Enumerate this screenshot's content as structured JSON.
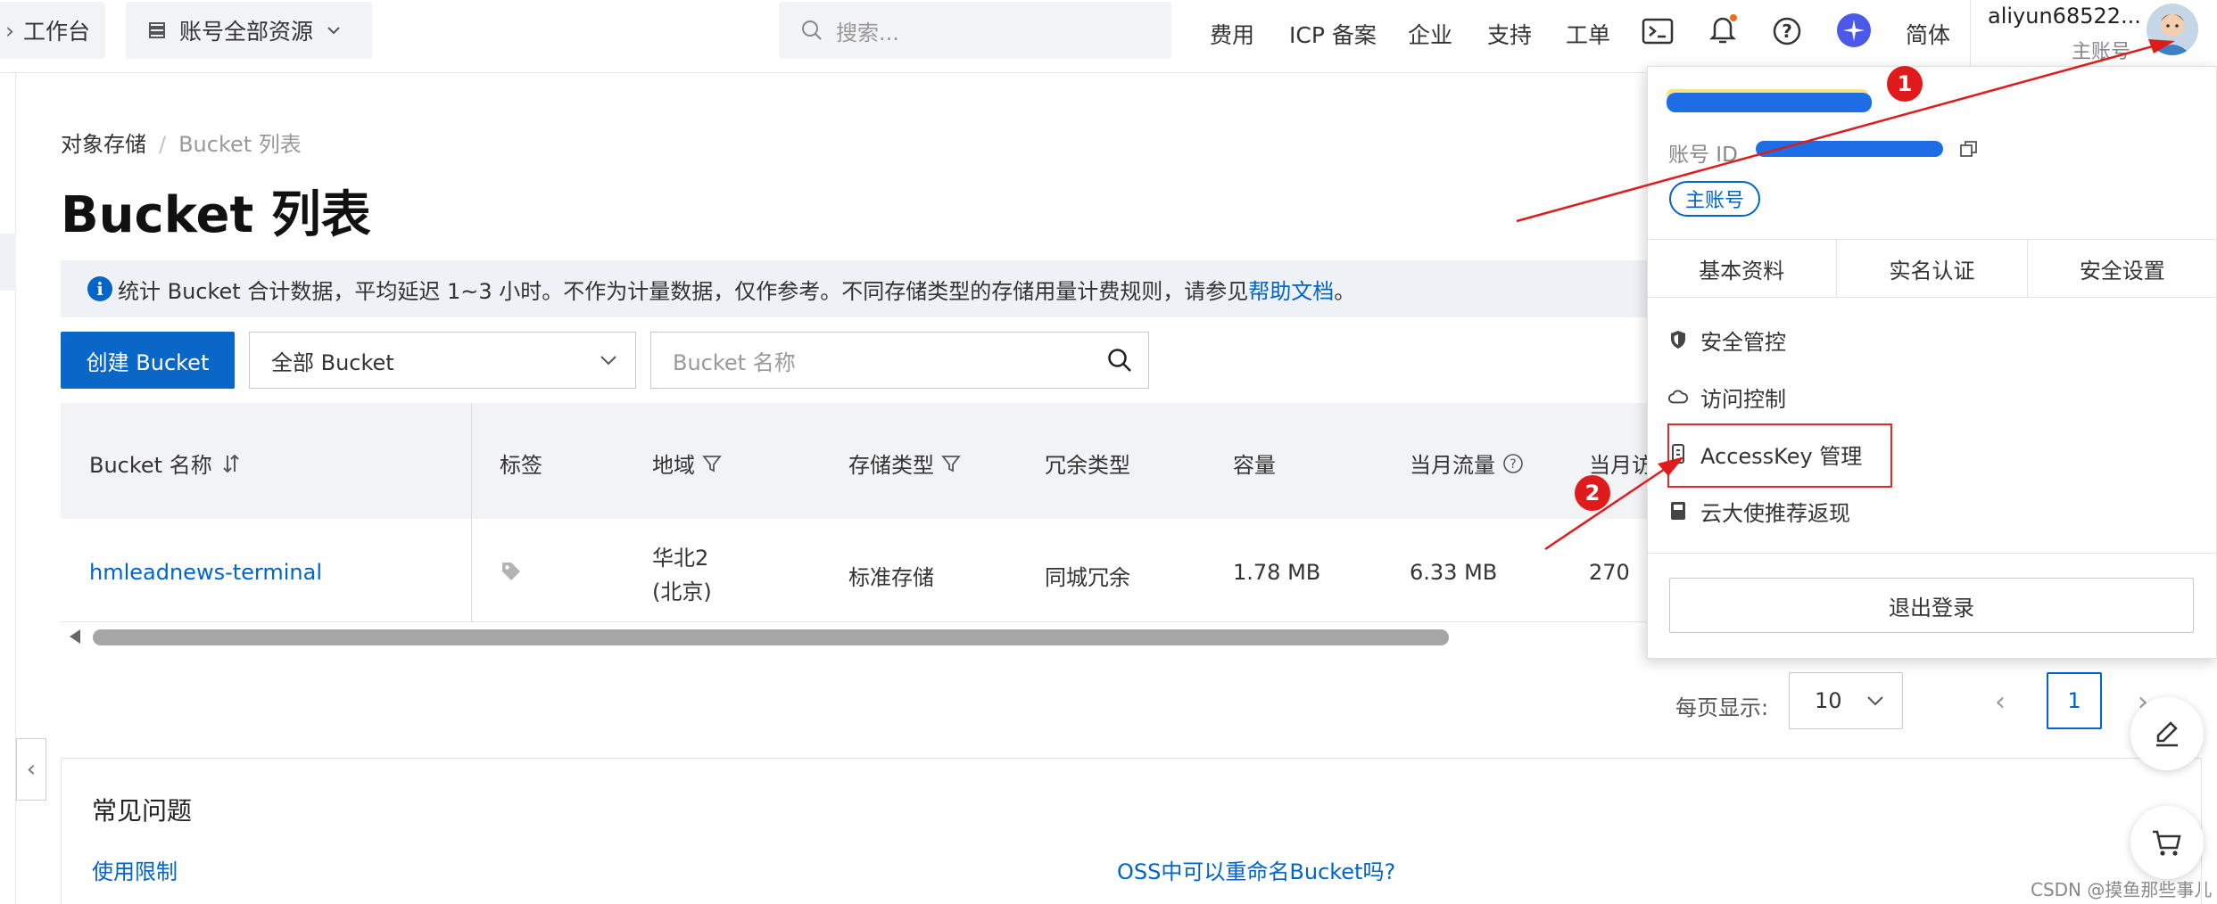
{
  "topbar": {
    "workbench": "工作台",
    "resources": "账号全部资源",
    "search_placeholder": "搜索...",
    "links": [
      "费用",
      "ICP 备案",
      "企业",
      "支持",
      "工单"
    ],
    "lang": "简体",
    "username": "aliyun68522...",
    "role": "主账号"
  },
  "breadcrumb": {
    "root": "对象存储",
    "sep": "/",
    "current": "Bucket 列表"
  },
  "page_title": "Bucket 列表",
  "notice": {
    "info_glyph": "i",
    "text": "统计 Bucket 合计数据，平均延迟 1~3 小时。不作为计量数据，仅作参考。不同存储类型的存储用量计费规则，请参见",
    "link": "帮助文档",
    "suffix": "。"
  },
  "toolbar": {
    "create_button": "创建 Bucket",
    "filter_value": "全部 Bucket",
    "name_placeholder": "Bucket 名称"
  },
  "table": {
    "headers": [
      "Bucket 名称",
      "标签",
      "地域",
      "存储类型",
      "冗余类型",
      "容量",
      "当月流量",
      "当月访"
    ],
    "rows": [
      {
        "name": "hmleadnews-terminal",
        "region_line1": "华北2",
        "region_line2": "(北京)",
        "storage": "标准存储",
        "redundancy": "同城冗余",
        "capacity": "1.78 MB",
        "traffic": "6.33 MB",
        "requests": "270"
      }
    ]
  },
  "pagination": {
    "per_page_label": "每页显示:",
    "page_size": "10",
    "current_page": "1",
    "prev": "‹",
    "next": "›"
  },
  "faq": {
    "title": "常见问题",
    "links": [
      "使用限制",
      "OSS中可以重命名Bucket吗?"
    ]
  },
  "account_menu": {
    "account_id_label": "账号 ID",
    "badge": "主账号",
    "tabs": [
      "基本资料",
      "实名认证",
      "安全设置"
    ],
    "items": [
      "安全管控",
      "访问控制",
      "AccessKey 管理",
      "云大使推荐返现"
    ],
    "logout": "退出登录"
  },
  "annotations": {
    "marker1": "1",
    "marker2": "2"
  },
  "sidebar": {
    "collapse_glyph": "‹"
  },
  "watermark": "CSDN @摸鱼那些事儿",
  "colors": {
    "primary": "#0064c8",
    "annotation_red": "#e01b1b"
  }
}
